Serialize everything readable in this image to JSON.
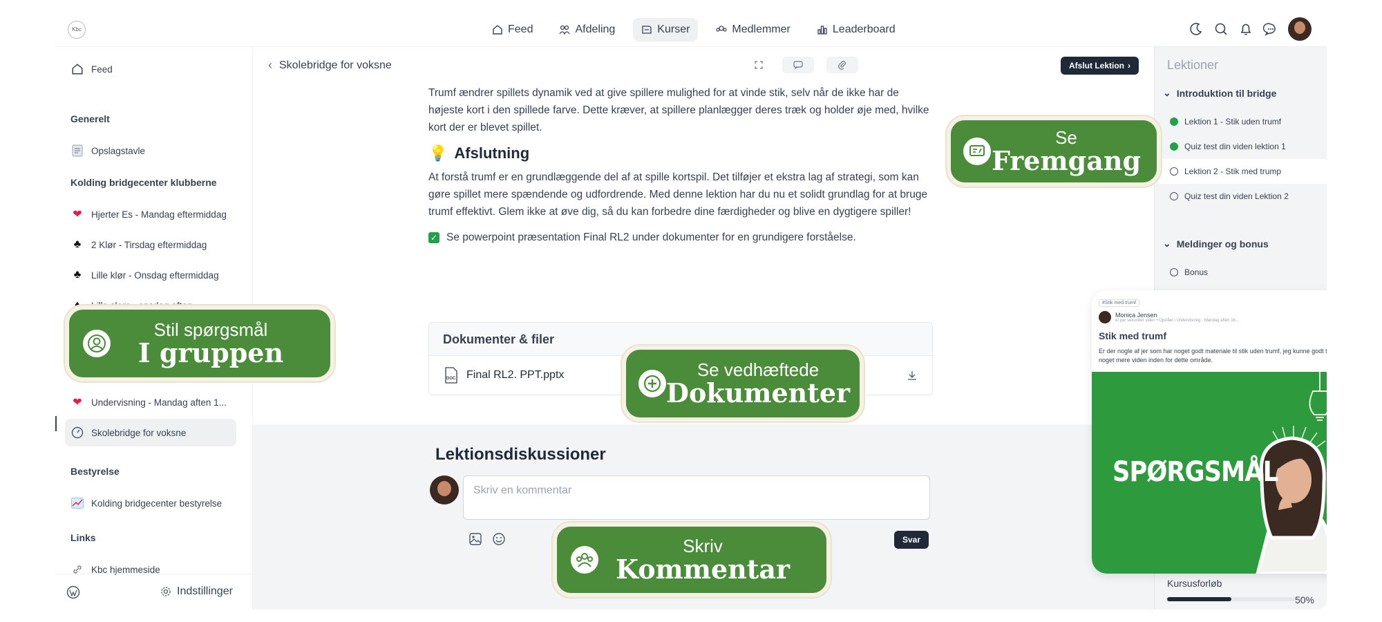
{
  "nav": {
    "logo_text": "Kbc",
    "items": [
      {
        "label": "Feed",
        "icon": "home-icon"
      },
      {
        "label": "Afdeling",
        "icon": "people-icon"
      },
      {
        "label": "Kurser",
        "icon": "courses-icon",
        "active": true
      },
      {
        "label": "Medlemmer",
        "icon": "members-icon"
      },
      {
        "label": "Leaderboard",
        "icon": "leaderboard-icon"
      }
    ]
  },
  "sidebar": {
    "feed": "Feed",
    "generelt": "Generelt",
    "opslagstavle": "Opslagstavle",
    "klubber_head": "Kolding bridgecenter klubberne",
    "klubber": [
      {
        "label": "Hjerter Es - Mandag eftermiddag",
        "icon": "❤️"
      },
      {
        "label": "2 Klør - Tirsdag eftermiddag",
        "icon": "♣"
      },
      {
        "label": "Lille klør - Onsdag eftermiddag",
        "icon": "♣"
      },
      {
        "label": "Lille slem - onsdag aften",
        "icon": "♦"
      }
    ],
    "undervisning": "Undervisning - Mandag aften 1...",
    "skolebridge": "Skolebridge for voksne",
    "bestyrelse_head": "Bestyrelse",
    "bestyrelse": "Kolding bridgecenter bestyrelse",
    "links_head": "Links",
    "hjemmeside": "Kbc hjemmeside",
    "settings": "Indstillinger"
  },
  "main": {
    "breadcrumb": "Skolebridge for voksne",
    "finish_button": "Afslut Lektion",
    "para1": "Trumf ændrer spillets dynamik ved at give spillere mulighed for at vinde stik, selv når de ikke har de højeste kort i den spillede farve. Dette kræver, at spillere planlægger deres træk og holder øje med, hvilke kort der er blevet spillet.",
    "heading_icon": "💡",
    "heading": "Afslutning",
    "para2": "At forstå trumf er en grundlæggende del af at spille kortspil. Det tilføjer et ekstra lag af strategi, som kan gøre spillet mere spændende og udfordrende. Med denne lektion har du nu et solidt grundlag for at bruge trumf effektivt. Glem ikke at øve dig, så du kan forbedre dine færdigheder og blive en dygtigere spiller!",
    "checklist": "Se powerpoint præsentation Final RL2 under dokumenter for en grundigere forståelse.",
    "docs_title": "Dokumenter & filer",
    "doc_file": "Final RL2. PPT.pptx",
    "doc_icon_text": "DOC"
  },
  "discussion": {
    "title": "Lektionsdiskussioner",
    "placeholder": "Skriv en kommentar",
    "reply": "Svar"
  },
  "lessons": {
    "title": "Lektioner",
    "section1": "Introduktion til bridge",
    "items1": [
      {
        "label": "Lektion 1 - Stik uden trumf",
        "done": true
      },
      {
        "label": "Quiz test din viden lektion 1",
        "done": true
      },
      {
        "label": "Lektion 2 - Stik med trump",
        "done": false
      },
      {
        "label": "Quiz test din viden Lektion 2",
        "done": false
      }
    ],
    "section2": "Meldinger og bonus",
    "items2": [
      {
        "label": "Bonus",
        "done": false
      }
    ],
    "progress_label": "Kursusforløb",
    "progress_pct": "50%",
    "progress_value": 0.5
  },
  "overlays": {
    "fremgang_small": "Se",
    "fremgang_big": "Fremgang",
    "gruppen_small": "Stil spørgsmål",
    "gruppen_big": "I gruppen",
    "dok_small": "Se vedhæftede",
    "dok_big": "Dokumenter",
    "komm_small": "Skriv",
    "komm_big": "Kommentar"
  },
  "card": {
    "tag": "#Stik med trumf",
    "author": "Monica Jensen",
    "meta": "et par sekunder siden • Opslået i Undervisning - Mandag aften 16...",
    "title": "Stik med trumf",
    "body": "Er der nogle af jer som har noget godt materiale til stik uden trumf, jeg kunne godt tænke mig noget mere viden inden for dette område.",
    "banner": "SPØRGSMÅL"
  },
  "colors": {
    "accent_green": "#4a8c3a",
    "check_green": "#22a14a",
    "dark": "#1f2937"
  }
}
